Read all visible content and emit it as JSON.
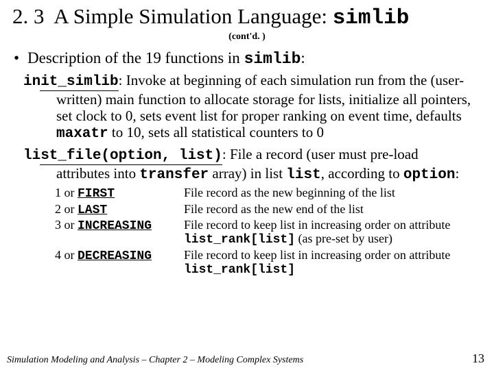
{
  "title": {
    "section": "2. 3",
    "text": "A Simple Simulation Language:",
    "code": "simlib"
  },
  "contd": "(cont'd. )",
  "b1": {
    "pre": "Description of the 19 functions in ",
    "code": "simlib",
    "post": ":"
  },
  "f1": {
    "name": "init_simlib",
    "colon": ":",
    "t1": "  Invoke at beginning of each simulation run from the (user-written) main function to allocate storage for lists, initialize all pointers, set clock to 0, sets event list for proper ranking on event time, defaults ",
    "c1": "maxatr",
    "t2": " to 10, sets all statistical counters to 0"
  },
  "f2": {
    "name": "list_file(option, list)",
    "colon": ":",
    "t1": "  File a record (user must pre-load attributes into ",
    "c1": "transfer",
    "t2": " array) in list ",
    "c2": "list",
    "t3": ", according to ",
    "c3": "option",
    "t4": ":"
  },
  "opts": [
    {
      "k1": "1 or ",
      "kc": "FIRST",
      "d": "File record as the new beginning of the list"
    },
    {
      "k1": "2 or ",
      "kc": "LAST",
      "d": "File record as the new end of the list"
    },
    {
      "k1": "3 or ",
      "kc": "INCREASING",
      "d": "File record to keep list in increasing order on attribute ",
      "dc": "list_rank[list]",
      "dp": " (as pre-set by user)"
    },
    {
      "k1": "4 or ",
      "kc": "DECREASING",
      "d": "File record to keep list in increasing order on attribute ",
      "dc": "list_rank[list]",
      "dp": ""
    }
  ],
  "footer": "Simulation Modeling and Analysis – Chapter 2 – Modeling Complex Systems",
  "page": "13"
}
